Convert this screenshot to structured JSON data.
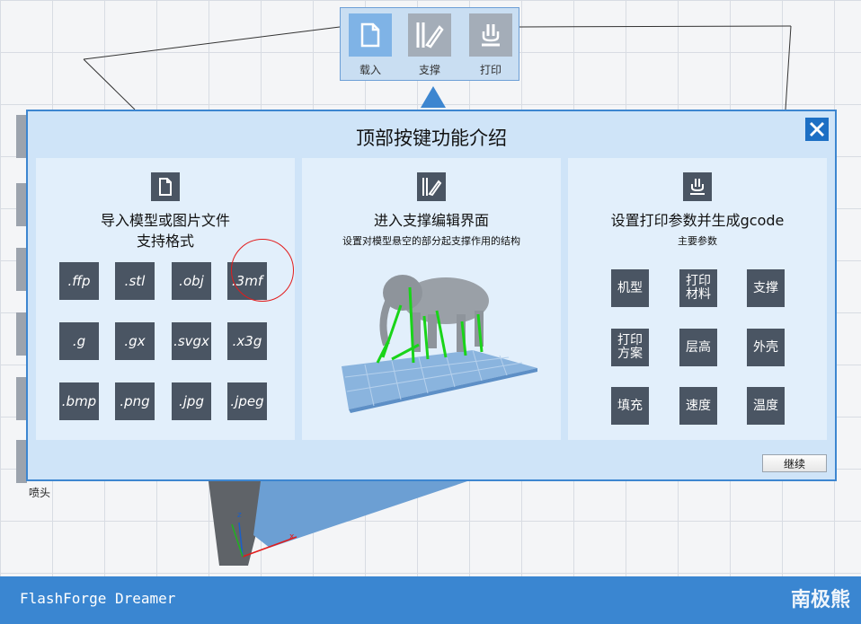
{
  "toolbar": {
    "buttons": [
      {
        "label": "载入",
        "icon": "file-load-icon"
      },
      {
        "label": "支撑",
        "icon": "support-pen-icon"
      },
      {
        "label": "打印",
        "icon": "print-icon"
      }
    ]
  },
  "left_panel": {
    "nozzle_label": "喷头"
  },
  "dialog": {
    "title": "顶部按键功能介绍",
    "panels": {
      "import": {
        "title_line1": "导入模型或图片文件",
        "title_line2": "支持格式",
        "formats": [
          ".ffp",
          ".stl",
          ".obj",
          ".3mf",
          ".g",
          ".gx",
          ".svgx",
          ".x3g",
          ".bmp",
          ".png",
          ".jpg",
          ".jpeg"
        ],
        "highlighted": ".3mf"
      },
      "support": {
        "title": "进入支撑编辑界面",
        "subtitle": "设置对模型悬空的部分起支撑作用的结构"
      },
      "print": {
        "title": "设置打印参数并生成gcode",
        "subtitle": "主要参数",
        "params": [
          "机型",
          "打印\n材料",
          "支撑",
          "打印\n方案",
          "层高",
          "外壳",
          "填充",
          "速度",
          "温度"
        ]
      }
    },
    "continue_label": "继续"
  },
  "axes": {
    "x": "x",
    "z": "z"
  },
  "statusbar": {
    "app_name": "FlashForge Dreamer",
    "watermark": "南极熊"
  },
  "colors": {
    "accent": "#3d86d0",
    "tile": "#4a5563",
    "dialog_bg": "#cfe4f8",
    "highlight_circle": "#e21b1b"
  }
}
